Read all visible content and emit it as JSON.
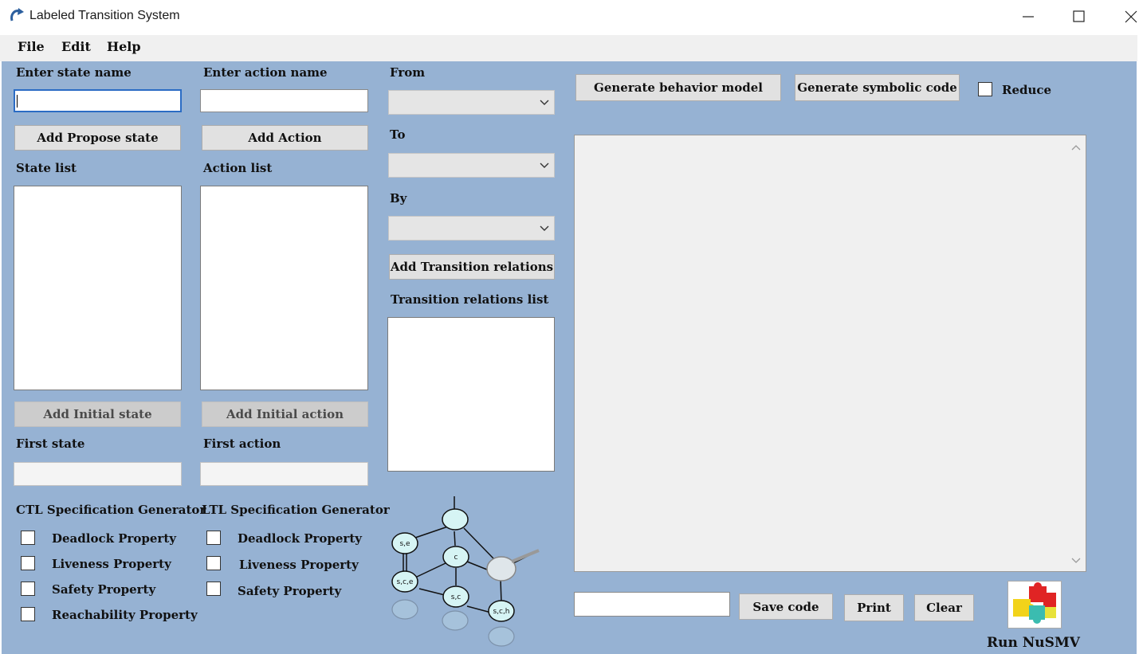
{
  "window": {
    "title": "Labeled Transition System",
    "controls": [
      "minimize-icon",
      "maximize-icon",
      "close-icon"
    ]
  },
  "menu": {
    "file": "File",
    "edit": "Edit",
    "help": "Help"
  },
  "states": {
    "label": "Enter state name",
    "input_value": "",
    "add_button": "Add Propose state",
    "list_label": "State list",
    "initial_button": "Add Initial state",
    "first_label": "First state",
    "first_value": ""
  },
  "actions": {
    "label": "Enter action name",
    "input_value": "",
    "add_button": "Add Action",
    "list_label": "Action list",
    "initial_button": "Add Initial action",
    "first_label": "First action",
    "first_value": ""
  },
  "transitions": {
    "from_label": "From",
    "to_label": "To",
    "by_label": "By",
    "add_button": "Add Transition relations",
    "list_label": "Transition relations list"
  },
  "ctl": {
    "title": "CTL Specification Generator",
    "options": [
      "Deadlock Property",
      "Liveness Property",
      "Safety Property",
      "Reachability Property"
    ]
  },
  "ltl": {
    "title": "LTL Specification Generator",
    "options": [
      "Deadlock Property",
      "Liveness Property",
      "Safety Property"
    ]
  },
  "graph_illustration": {
    "nodes": [
      "s,e",
      "c",
      "s,c,e",
      "s,c",
      "s,c,h"
    ]
  },
  "output": {
    "generate_model_button": "Generate behavior model",
    "generate_code_button": "Generate symbolic code",
    "reduce_label": "Reduce",
    "code_text": "",
    "filename_value": "",
    "save_button": "Save code",
    "print_button": "Print",
    "clear_button": "Clear",
    "run_label": "Run NuSMV"
  },
  "colors": {
    "client_bg": "#96b2d3",
    "button_bg": "#e1e1e1"
  }
}
